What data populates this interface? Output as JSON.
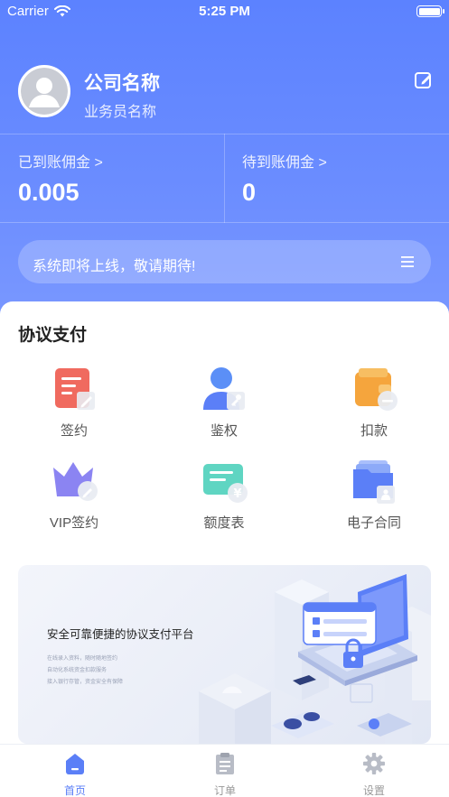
{
  "status_bar": {
    "carrier": "Carrier",
    "time": "5:25 PM"
  },
  "profile": {
    "company_name": "公司名称",
    "agent_name": "业务员名称"
  },
  "stats": {
    "received_label": "已到账佣金 >",
    "received_value": "0.005",
    "pending_label": "待到账佣金 >",
    "pending_value": "0"
  },
  "notice": {
    "text": "系统即将上线，敬请期待!"
  },
  "section": {
    "title": "协议支付",
    "items": [
      {
        "label": "签约",
        "icon": "contract-icon"
      },
      {
        "label": "鉴权",
        "icon": "user-key-icon"
      },
      {
        "label": "扣款",
        "icon": "wallet-icon"
      },
      {
        "label": "VIP签约",
        "icon": "crown-icon"
      },
      {
        "label": "额度表",
        "icon": "quota-card-icon"
      },
      {
        "label": "电子合同",
        "icon": "folder-icon"
      }
    ]
  },
  "banner": {
    "title": "安全可靠便捷的协议支付平台",
    "lines": [
      "在线录入资料，随时随地签约",
      "自动化系统资金扣款服务",
      "接入银行存管，资金安全有保障"
    ]
  },
  "tabbar": {
    "tabs": [
      {
        "label": "首页",
        "icon": "home-icon",
        "active": true
      },
      {
        "label": "订单",
        "icon": "clipboard-icon",
        "active": false
      },
      {
        "label": "设置",
        "icon": "gear-icon",
        "active": false
      }
    ]
  },
  "colors": {
    "primary": "#5b7ff7",
    "hero_top": "#5c82ff",
    "hero_bottom": "#7a98ff",
    "red_icon": "#f06a5f",
    "orange_icon": "#f5a53d",
    "purple_icon": "#8b84f2",
    "teal_icon": "#5fd5c2"
  }
}
